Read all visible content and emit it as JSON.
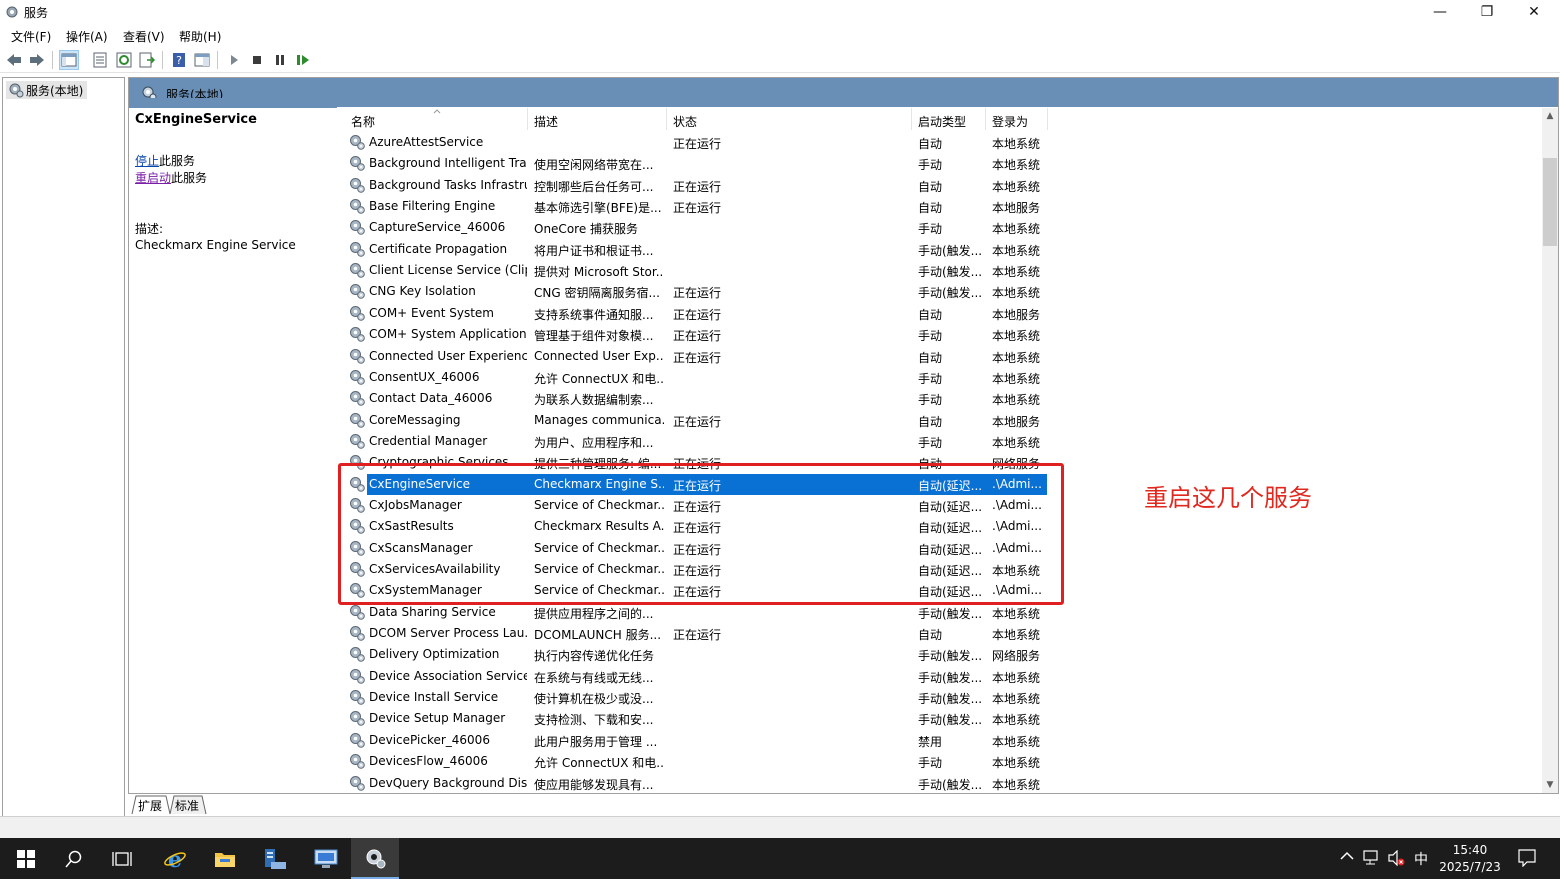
{
  "window": {
    "title": "服务",
    "minimize": "—",
    "restore": "❐",
    "close": "✕"
  },
  "menu": [
    "文件(F)",
    "操作(A)",
    "查看(V)",
    "帮助(H)"
  ],
  "tree": {
    "node": "服务(本地)"
  },
  "pane": {
    "title": "服务(本地)"
  },
  "details": {
    "service_name": "CxEngineService",
    "stop_link": "停止",
    "stop_suffix": "此服务",
    "restart_link": "重启动",
    "restart_suffix": "此服务",
    "desc_label": "描述:",
    "desc_text": "Checkmarx Engine Service"
  },
  "columns": {
    "name": "名称",
    "desc": "描述",
    "status": "状态",
    "startup": "启动类型",
    "logon": "登录为"
  },
  "rows": [
    {
      "name": "AzureAttestService",
      "desc": "",
      "status": "正在运行",
      "startup": "自动",
      "logon": "本地系统"
    },
    {
      "name": "Background Intelligent Tra...",
      "desc": "使用空闲网络带宽在...",
      "status": "",
      "startup": "手动",
      "logon": "本地系统"
    },
    {
      "name": "Background Tasks Infrastru...",
      "desc": "控制哪些后台任务可...",
      "status": "正在运行",
      "startup": "自动",
      "logon": "本地系统"
    },
    {
      "name": "Base Filtering Engine",
      "desc": "基本筛选引擎(BFE)是...",
      "status": "正在运行",
      "startup": "自动",
      "logon": "本地服务"
    },
    {
      "name": "CaptureService_46006",
      "desc": "OneCore 捕获服务",
      "status": "",
      "startup": "手动",
      "logon": "本地系统"
    },
    {
      "name": "Certificate Propagation",
      "desc": "将用户证书和根证书...",
      "status": "",
      "startup": "手动(触发...",
      "logon": "本地系统"
    },
    {
      "name": "Client License Service (Clip...",
      "desc": "提供对 Microsoft Stor...",
      "status": "",
      "startup": "手动(触发...",
      "logon": "本地系统"
    },
    {
      "name": "CNG Key Isolation",
      "desc": "CNG 密钥隔离服务宿...",
      "status": "正在运行",
      "startup": "手动(触发...",
      "logon": "本地系统"
    },
    {
      "name": "COM+ Event System",
      "desc": "支持系统事件通知服...",
      "status": "正在运行",
      "startup": "自动",
      "logon": "本地服务"
    },
    {
      "name": "COM+ System Application",
      "desc": "管理基于组件对象模...",
      "status": "正在运行",
      "startup": "手动",
      "logon": "本地系统"
    },
    {
      "name": "Connected User Experienc...",
      "desc": "Connected User Exp...",
      "status": "正在运行",
      "startup": "自动",
      "logon": "本地系统"
    },
    {
      "name": "ConsentUX_46006",
      "desc": "允许 ConnectUX 和电...",
      "status": "",
      "startup": "手动",
      "logon": "本地系统"
    },
    {
      "name": "Contact Data_46006",
      "desc": "为联系人数据编制索...",
      "status": "",
      "startup": "手动",
      "logon": "本地系统"
    },
    {
      "name": "CoreMessaging",
      "desc": "Manages communica...",
      "status": "正在运行",
      "startup": "自动",
      "logon": "本地服务"
    },
    {
      "name": "Credential Manager",
      "desc": "为用户、应用程序和...",
      "status": "",
      "startup": "手动",
      "logon": "本地系统"
    },
    {
      "name": "Cryptographic Services",
      "desc": "提供三种管理服务: 编...",
      "status": "正在运行",
      "startup": "自动",
      "logon": "网络服务"
    },
    {
      "name": "CxEngineService",
      "desc": "Checkmarx Engine S...",
      "status": "正在运行",
      "startup": "自动(延迟...",
      "logon": ".\\Admi...",
      "selected": true
    },
    {
      "name": "CxJobsManager",
      "desc": "Service of Checkmar...",
      "status": "正在运行",
      "startup": "自动(延迟...",
      "logon": ".\\Admi..."
    },
    {
      "name": "CxSastResults",
      "desc": "Checkmarx Results A...",
      "status": "正在运行",
      "startup": "自动(延迟...",
      "logon": ".\\Admi..."
    },
    {
      "name": "CxScansManager",
      "desc": "Service of Checkmar...",
      "status": "正在运行",
      "startup": "自动(延迟...",
      "logon": ".\\Admi..."
    },
    {
      "name": "CxServicesAvailability",
      "desc": "Service of Checkmar...",
      "status": "正在运行",
      "startup": "自动(延迟...",
      "logon": "本地系统"
    },
    {
      "name": "CxSystemManager",
      "desc": "Service of Checkmar...",
      "status": "正在运行",
      "startup": "自动(延迟...",
      "logon": ".\\Admi..."
    },
    {
      "name": "Data Sharing Service",
      "desc": "提供应用程序之间的...",
      "status": "",
      "startup": "手动(触发...",
      "logon": "本地系统"
    },
    {
      "name": "DCOM Server Process Lau...",
      "desc": "DCOMLAUNCH 服务...",
      "status": "正在运行",
      "startup": "自动",
      "logon": "本地系统"
    },
    {
      "name": "Delivery Optimization",
      "desc": "执行内容传递优化任务",
      "status": "",
      "startup": "手动(触发...",
      "logon": "网络服务"
    },
    {
      "name": "Device Association Service",
      "desc": "在系统与有线或无线...",
      "status": "",
      "startup": "手动(触发...",
      "logon": "本地系统"
    },
    {
      "name": "Device Install Service",
      "desc": "使计算机在极少或没...",
      "status": "",
      "startup": "手动(触发...",
      "logon": "本地系统"
    },
    {
      "name": "Device Setup Manager",
      "desc": "支持检测、下载和安...",
      "status": "",
      "startup": "手动(触发...",
      "logon": "本地系统"
    },
    {
      "name": "DevicePicker_46006",
      "desc": "此用户服务用于管理 ...",
      "status": "",
      "startup": "禁用",
      "logon": "本地系统"
    },
    {
      "name": "DevicesFlow_46006",
      "desc": "允许 ConnectUX 和电...",
      "status": "",
      "startup": "手动",
      "logon": "本地系统"
    },
    {
      "name": "DevQuery Background Dis...",
      "desc": "使应用能够发现具有...",
      "status": "",
      "startup": "手动(触发...",
      "logon": "本地系统"
    }
  ],
  "tabs": [
    "扩展",
    "标准"
  ],
  "annotation": "重启这几个服务",
  "taskbar": {
    "time": "15:40",
    "date": "2025/7/23",
    "ime": "中"
  },
  "colors": {
    "header_blue": "#6a8fb7",
    "selection": "#0a71d4",
    "annotation_red": "#e02020"
  }
}
